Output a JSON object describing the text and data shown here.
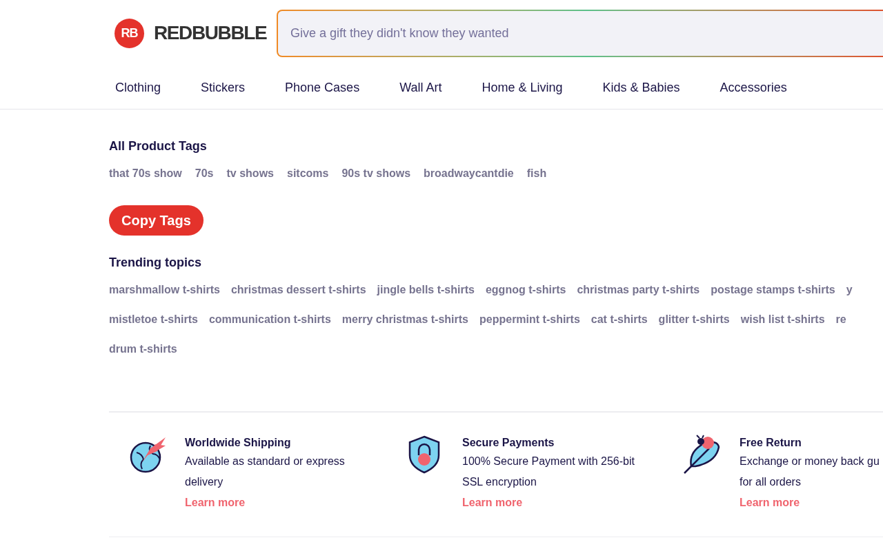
{
  "header": {
    "logo": {
      "mark": "RB",
      "name": "REDBUBBLE"
    },
    "search": {
      "placeholder": "Give a gift they didn't know they wanted"
    }
  },
  "nav": [
    "Clothing",
    "Stickers",
    "Phone Cases",
    "Wall Art",
    "Home & Living",
    "Kids & Babies",
    "Accessories"
  ],
  "product_tags": {
    "title": "All Product Tags",
    "tags": [
      "that 70s show",
      "70s",
      "tv shows",
      "sitcoms",
      "90s tv shows",
      "broadwaycantdie",
      "fish"
    ]
  },
  "copy_button": "Copy Tags",
  "trending": {
    "title": "Trending topics",
    "lines": [
      {
        "topics": [
          "marshmallow t-shirts",
          "christmas dessert t-shirts",
          "jingle bells t-shirts",
          "eggnog t-shirts",
          "christmas party t-shirts",
          "postage stamps t-shirts",
          "y"
        ]
      },
      {
        "topics": [
          "mistletoe t-shirts",
          "communication t-shirts",
          "merry christmas t-shirts",
          "peppermint t-shirts",
          "cat t-shirts",
          "glitter t-shirts",
          "wish list t-shirts",
          "re"
        ]
      },
      {
        "topics": [
          "drum t-shirts"
        ]
      }
    ]
  },
  "features": [
    {
      "kind": "shipping",
      "title": "Worldwide Shipping",
      "lines": [
        "Available as standard or express",
        "delivery"
      ],
      "link": "Learn more"
    },
    {
      "kind": "payments",
      "title": "Secure Payments",
      "lines": [
        "100% Secure Payment with 256-bit",
        "SSL encryption"
      ],
      "link": "Learn more"
    },
    {
      "kind": "return",
      "title": "Free Return",
      "lines": [
        "Exchange or money back gu",
        "for all orders"
      ],
      "link": "Learn more"
    }
  ]
}
